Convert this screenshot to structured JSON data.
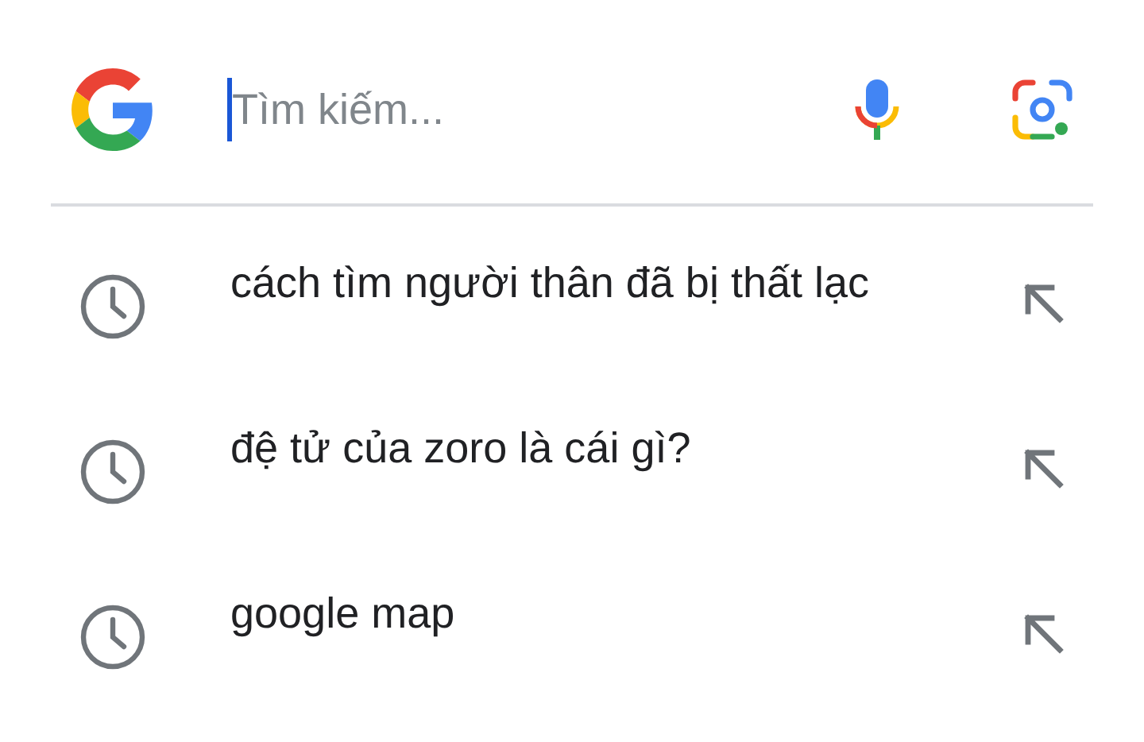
{
  "search": {
    "placeholder": "Tìm kiếm..."
  },
  "suggestions": [
    {
      "text": "cách tìm người thân đã bị thất lạc"
    },
    {
      "text": "đệ tử của zoro là cái gì?"
    },
    {
      "text": "google map"
    }
  ]
}
